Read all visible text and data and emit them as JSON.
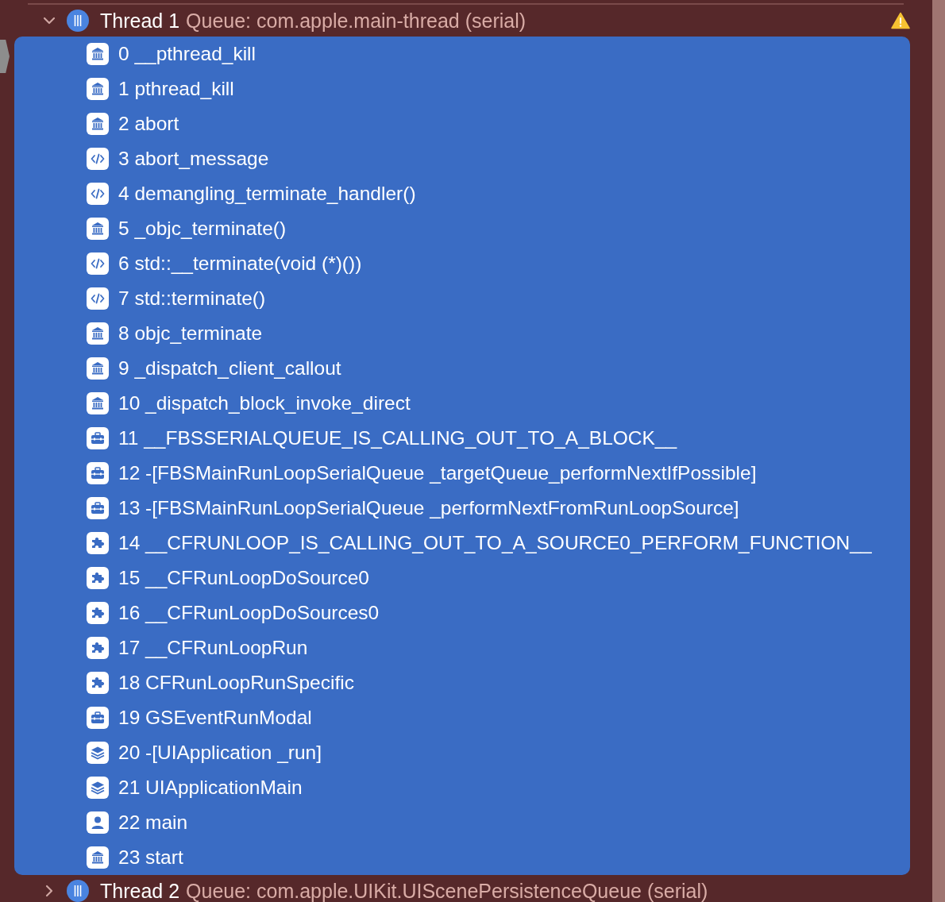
{
  "threads": [
    {
      "name": "Thread 1",
      "queue": "Queue: com.apple.main-thread (serial)",
      "expanded": true,
      "warning": true,
      "frames": [
        {
          "label": "0 __pthread_kill",
          "kind": "library",
          "selected": true
        },
        {
          "label": "1 pthread_kill",
          "kind": "library",
          "selected": true
        },
        {
          "label": "2 abort",
          "kind": "library",
          "selected": true
        },
        {
          "label": "3 abort_message",
          "kind": "source",
          "selected": true
        },
        {
          "label": "4 demangling_terminate_handler()",
          "kind": "source",
          "selected": true
        },
        {
          "label": "5 _objc_terminate()",
          "kind": "library",
          "selected": true
        },
        {
          "label": "6 std::__terminate(void (*)())",
          "kind": "source",
          "selected": true
        },
        {
          "label": "7 std::terminate()",
          "kind": "source",
          "selected": true
        },
        {
          "label": "8 objc_terminate",
          "kind": "library",
          "selected": true
        },
        {
          "label": "9 _dispatch_client_callout",
          "kind": "library",
          "selected": true
        },
        {
          "label": "10 _dispatch_block_invoke_direct",
          "kind": "library",
          "selected": true
        },
        {
          "label": "11 __FBSSERIALQUEUE_IS_CALLING_OUT_TO_A_BLOCK__",
          "kind": "toolbox",
          "selected": true
        },
        {
          "label": "12 -[FBSMainRunLoopSerialQueue _targetQueue_performNextIfPossible]",
          "kind": "toolbox",
          "selected": true
        },
        {
          "label": "13 -[FBSMainRunLoopSerialQueue _performNextFromRunLoopSource]",
          "kind": "toolbox",
          "selected": true
        },
        {
          "label": "14 __CFRUNLOOP_IS_CALLING_OUT_TO_A_SOURCE0_PERFORM_FUNCTION__",
          "kind": "puzzle",
          "selected": true
        },
        {
          "label": "15 __CFRunLoopDoSource0",
          "kind": "puzzle",
          "selected": true
        },
        {
          "label": "16 __CFRunLoopDoSources0",
          "kind": "puzzle",
          "selected": true
        },
        {
          "label": "17 __CFRunLoopRun",
          "kind": "puzzle",
          "selected": true
        },
        {
          "label": "18 CFRunLoopRunSpecific",
          "kind": "puzzle",
          "selected": true
        },
        {
          "label": "19 GSEventRunModal",
          "kind": "toolbox",
          "selected": true
        },
        {
          "label": "20 -[UIApplication _run]",
          "kind": "stack",
          "selected": true
        },
        {
          "label": "21 UIApplicationMain",
          "kind": "stack",
          "selected": true
        },
        {
          "label": "22 main",
          "kind": "user",
          "selected": true
        },
        {
          "label": "23 start",
          "kind": "library",
          "selected": true
        }
      ]
    },
    {
      "name": "Thread 2",
      "queue": "Queue: com.apple.UIKit.UIScenePersistenceQueue (serial)",
      "expanded": false,
      "warning": false
    }
  ]
}
